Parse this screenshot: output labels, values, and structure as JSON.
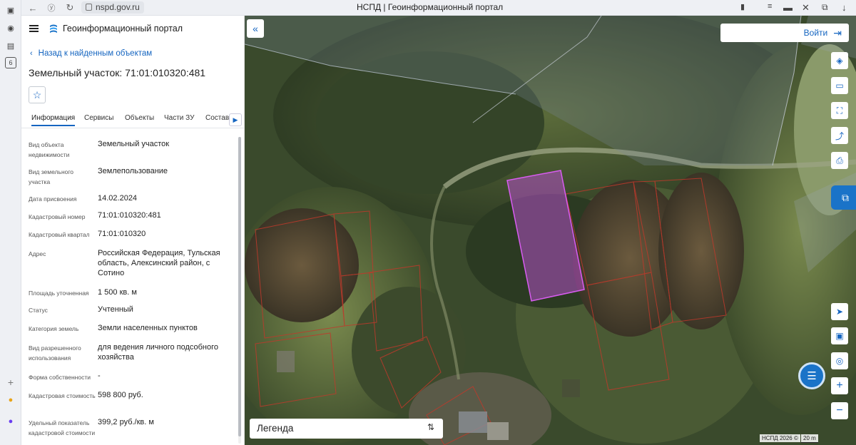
{
  "browser": {
    "url": "nspd.gov.ru",
    "title": "НСПД | Геоинформационный портал",
    "tab_count": "6"
  },
  "header": {
    "portal_name": "Геоинформационный портал"
  },
  "back_link": "Назад к найденным объектам",
  "object_title": "Земельный участок: 71:01:010320:481",
  "tabs": [
    {
      "label": "Информация"
    },
    {
      "label": "Сервисы"
    },
    {
      "label": "Объекты"
    },
    {
      "label": "Части ЗУ"
    },
    {
      "label": "Состав"
    }
  ],
  "properties": [
    {
      "label": "Вид объекта недвижимости",
      "value": "Земельный участок"
    },
    {
      "label": "Вид земельного участка",
      "value": "Землепользование"
    },
    {
      "label": "Дата присвоения",
      "value": "14.02.2024"
    },
    {
      "label": "Кадастровый номер",
      "value": "71:01:010320:481"
    },
    {
      "label": "Кадастровый квартал",
      "value": "71:01:010320"
    },
    {
      "label": "Адрес",
      "value": "Российская Федерация, Тульская область, Алексинский район, с Сотино"
    },
    {
      "label": "Площадь уточненная",
      "value": "1 500 кв. м"
    },
    {
      "label": "Статус",
      "value": "Учтенный"
    },
    {
      "label": "Категория земель",
      "value": "Земли населенных пунктов"
    },
    {
      "label": "Вид разрешенного использования",
      "value": "для ведения личного подсобного хозяйства"
    },
    {
      "label": "Форма собственности",
      "value": "-"
    },
    {
      "label": "Кадастровая стоимость",
      "value": "598 800 руб."
    },
    {
      "label": "Удельный показатель кадастровой стоимости",
      "value": "399,2 руб./кв. м"
    }
  ],
  "map": {
    "login_label": "Войти",
    "legend_label": "Легенда",
    "copyright": "НСПД 2026 ©",
    "scale": "20 m",
    "highlight_color": "#c04fd6",
    "parcel_color": "#c0392b"
  }
}
